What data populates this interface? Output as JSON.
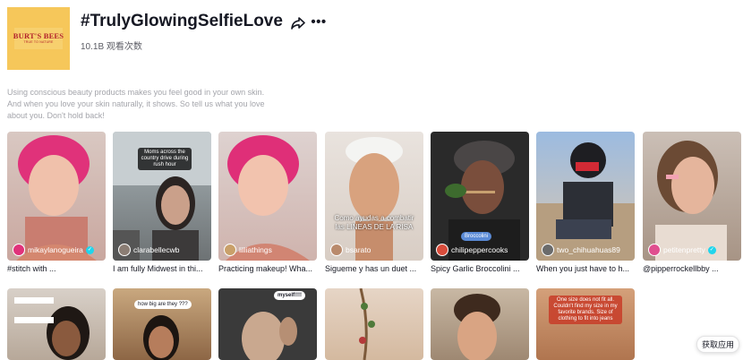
{
  "header": {
    "logo_text": "BURT'S BEES",
    "logo_subtext": "TRUE TO NATURE",
    "title": "#TrulyGlowingSelfieLove",
    "views": "10.1B 观看次数"
  },
  "icons": {
    "share": "share-icon",
    "more": "more-icon"
  },
  "description": "Using conscious beauty products makes you feel good in your own skin. And when you love your skin naturally, it shows. So tell us what you love about you. Don't hold back!",
  "videos": [
    {
      "username": "mikaylanogueira",
      "verified": true,
      "caption": "#stitch with ...",
      "overlay": ""
    },
    {
      "username": "clarabellecwb",
      "verified": false,
      "caption": "I am fully Midwest in thi...",
      "overlay": "Moms across the country drive during rush hour"
    },
    {
      "username": "lilliathings",
      "verified": false,
      "caption": "Practicing makeup! Wha...",
      "overlay": ""
    },
    {
      "username": "bsarato",
      "verified": false,
      "caption": "Sigueme y has un duet ...",
      "overlay": "Como ayudas a combatir las LINEAS DE LA RISA"
    },
    {
      "username": "chilipeppercooks",
      "verified": false,
      "caption": "Spicy Garlic Broccolini ...",
      "overlay": "Broccolini"
    },
    {
      "username": "two_chihuahuas89",
      "verified": false,
      "caption": "When you just have to h...",
      "overlay": ""
    },
    {
      "username": "petitenpretty",
      "verified": true,
      "caption": "@pipperrockellbby ...",
      "overlay": ""
    }
  ],
  "videos_row2": [
    {
      "overlay": ""
    },
    {
      "overlay": "how big are they ???"
    },
    {
      "overlay": "myself!!!!"
    },
    {
      "overlay": ""
    },
    {
      "overlay": ""
    },
    {
      "overlay": "One size does not fit all. Couldn't find my size in my favorite brands. Size of clothing to fit into jeans"
    }
  ],
  "get_app": "获取应用",
  "colors": {
    "logo_bg": "#f6c75a",
    "logo_text": "#b3222b",
    "verified": "#20d5ec"
  }
}
